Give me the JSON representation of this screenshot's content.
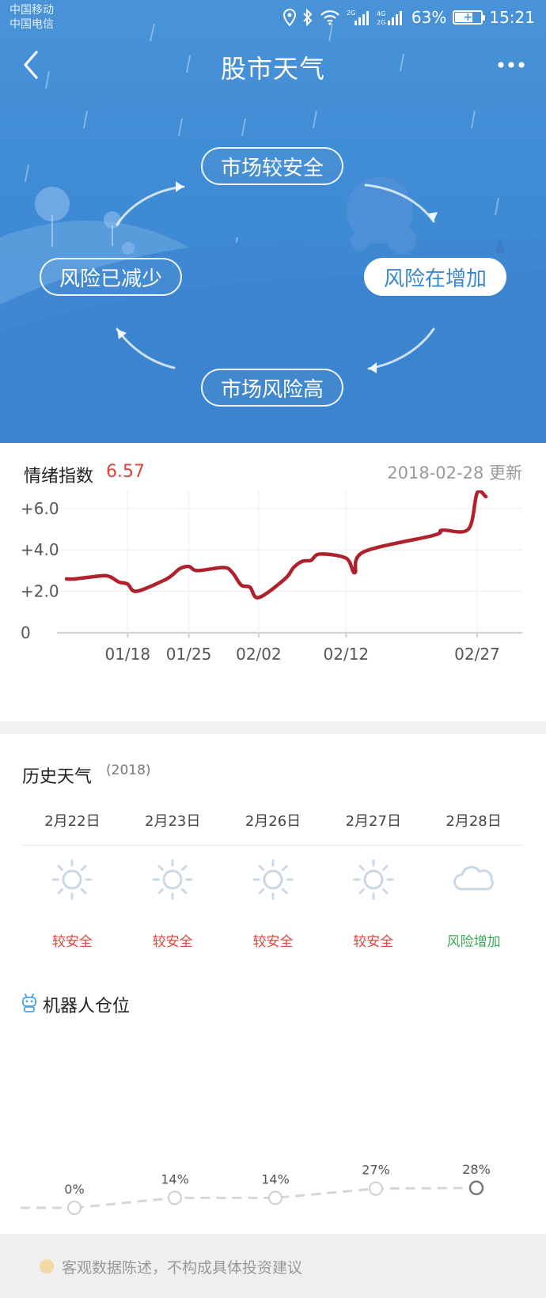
{
  "status_bar": {
    "carrier_1": "中国移动",
    "carrier_2": "中国电信",
    "battery": "63%",
    "time": "15:21",
    "icons": [
      "location-icon",
      "bluetooth-icon",
      "wifi-icon",
      "signal-icon",
      "signal-icon",
      "battery-icon"
    ]
  },
  "nav": {
    "title": "股市天气"
  },
  "cycle": {
    "safe": "市场较安全",
    "increasing": "风险在增加",
    "high": "市场风险高",
    "decreasing": "风险已减少",
    "active": "increasing"
  },
  "sentiment": {
    "title": "情绪指数",
    "value": "6.57",
    "updated_date": "2018-02-28",
    "updated_suffix": "更新"
  },
  "chart_data": {
    "type": "line",
    "y_ticks": [
      "+6.0",
      "+4.0",
      "+2.0",
      "0"
    ],
    "y_tick_values": [
      6,
      4,
      2,
      0
    ],
    "x_ticks": [
      "01/18",
      "01/25",
      "02/02",
      "02/12",
      "02/27"
    ],
    "ylim": [
      0,
      6.8
    ],
    "series": [
      {
        "color": "#b0212e",
        "x": [
          "01/11",
          "01/12",
          "01/15",
          "01/16",
          "01/17",
          "01/18",
          "01/19",
          "01/22",
          "01/23",
          "01/24",
          "01/25",
          "01/26",
          "01/29",
          "01/30",
          "01/31",
          "02/01",
          "02/02",
          "02/05",
          "02/06",
          "02/07",
          "02/08",
          "02/09",
          "02/12",
          "02/13",
          "02/14",
          "02/22",
          "02/23",
          "02/26",
          "02/27",
          "02/28"
        ],
        "values": [
          2.6,
          2.6,
          2.75,
          2.7,
          2.45,
          2.35,
          2.0,
          2.5,
          2.75,
          3.1,
          3.2,
          3.0,
          3.15,
          2.9,
          2.3,
          2.2,
          1.7,
          2.6,
          3.15,
          3.45,
          3.5,
          3.8,
          3.6,
          2.9,
          3.9,
          4.7,
          4.95,
          5.0,
          6.75,
          6.57
        ]
      }
    ]
  },
  "history": {
    "title": "历史天气",
    "year": "(2018)",
    "days": [
      {
        "date": "2月22日",
        "icon": "sun-icon",
        "label": "较安全",
        "tone": "red"
      },
      {
        "date": "2月23日",
        "icon": "sun-icon",
        "label": "较安全",
        "tone": "red"
      },
      {
        "date": "2月26日",
        "icon": "sun-icon",
        "label": "较安全",
        "tone": "red"
      },
      {
        "date": "2月27日",
        "icon": "sun-icon",
        "label": "较安全",
        "tone": "red"
      },
      {
        "date": "2月28日",
        "icon": "cloud-icon",
        "label": "风险增加",
        "tone": "green"
      }
    ]
  },
  "robot": {
    "title": "机器人仓位",
    "positions": [
      {
        "label": "0%",
        "value": 0
      },
      {
        "label": "14%",
        "value": 14
      },
      {
        "label": "14%",
        "value": 14
      },
      {
        "label": "27%",
        "value": 27
      },
      {
        "label": "28%",
        "value": 28
      }
    ]
  },
  "footer": {
    "disclaimer": "客观数据陈述，不构成具体投资建议"
  },
  "colors": {
    "hero": "#3a86d2",
    "accent_red": "#d9453c",
    "line_red": "#b0212e",
    "green": "#3aa957"
  }
}
